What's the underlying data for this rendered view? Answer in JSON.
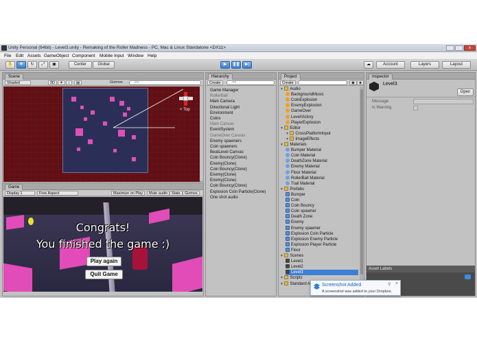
{
  "window": {
    "title": "Unity Personal (64bit) - Level3.unity - Remaking of the Roller Madness - PC, Mac & Linux Standalone <DX11>"
  },
  "menu": [
    "File",
    "Edit",
    "Assets",
    "GameObject",
    "Component",
    "Mobile Input",
    "Window",
    "Help"
  ],
  "toolbar": {
    "pivot": "Center",
    "space": "Global",
    "account": "Account",
    "layers": "Layers",
    "layout": "Layout"
  },
  "scene": {
    "tab": "Scene",
    "shading": "Shaded",
    "mode2d": "2D",
    "gizmos": "Gizmos",
    "search_placeholder": "All",
    "orientation": "Top"
  },
  "game": {
    "tab": "Game",
    "display": "Display 1",
    "aspect": "Free Aspect",
    "maximize": "Maximize on Play",
    "mute": "Mute audio",
    "stats": "Stats",
    "gizmos": "Gizmos",
    "line1": "Congrats!",
    "line2": "You finished the game :)",
    "play_again": "Play again",
    "quit_game": "Quit Game"
  },
  "hierarchy": {
    "tab": "Hierarchy",
    "create": "Create",
    "search_placeholder": "All",
    "items": [
      {
        "label": "Game Manager",
        "dim": false
      },
      {
        "label": "RollerBall",
        "dim": true
      },
      {
        "label": "Main Camera",
        "dim": false
      },
      {
        "label": "Directional Light",
        "dim": false
      },
      {
        "label": "Environment",
        "dim": false
      },
      {
        "label": "Coins",
        "dim": false
      },
      {
        "label": "Main Canvas",
        "dim": true
      },
      {
        "label": "EventSystem",
        "dim": false
      },
      {
        "label": "GameOver Canvas",
        "dim": true
      },
      {
        "label": "Enemy spawners",
        "dim": false
      },
      {
        "label": "Coin spawners",
        "dim": false
      },
      {
        "label": "BeatLevel Canvas",
        "dim": false
      },
      {
        "label": "Coin Bouncy(Clone)",
        "dim": false
      },
      {
        "label": "Enemy(Clone)",
        "dim": false
      },
      {
        "label": "Coin Bouncy(Clone)",
        "dim": false
      },
      {
        "label": "Enemy(Clone)",
        "dim": false
      },
      {
        "label": "Enemy(Clone)",
        "dim": false
      },
      {
        "label": "Coin Bouncy(Clone)",
        "dim": false
      },
      {
        "label": "Explosion Coin Particle(Clone)",
        "dim": false
      },
      {
        "label": "One shot audio",
        "dim": false
      }
    ]
  },
  "project": {
    "tab": "Project",
    "create": "Create",
    "items": [
      {
        "label": "Audio",
        "kind": "folder",
        "level": 0
      },
      {
        "label": "BackgroundMusic",
        "kind": "audio",
        "level": 1
      },
      {
        "label": "CoinExplosion",
        "kind": "audio",
        "level": 1
      },
      {
        "label": "EnemyExplosion",
        "kind": "audio",
        "level": 1
      },
      {
        "label": "GameOver",
        "kind": "audio",
        "level": 1
      },
      {
        "label": "LevelVictory",
        "kind": "audio",
        "level": 1
      },
      {
        "label": "PlayerExplosion",
        "kind": "audio",
        "level": 1
      },
      {
        "label": "Editor",
        "kind": "folder",
        "level": 0
      },
      {
        "label": "CrossPlatformInput",
        "kind": "folder",
        "level": 1
      },
      {
        "label": "ImageEffects",
        "kind": "folder",
        "level": 1
      },
      {
        "label": "Materials",
        "kind": "folder",
        "level": 0
      },
      {
        "label": "Bumper Material",
        "kind": "mat",
        "level": 1
      },
      {
        "label": "Coin Material",
        "kind": "mat",
        "level": 1
      },
      {
        "label": "DeathZone Material",
        "kind": "mat",
        "level": 1
      },
      {
        "label": "Enemy Material",
        "kind": "mat",
        "level": 1
      },
      {
        "label": "Floor Material",
        "kind": "mat",
        "level": 1
      },
      {
        "label": "RollerBall Material",
        "kind": "mat",
        "level": 1
      },
      {
        "label": "Trail Material",
        "kind": "mat",
        "level": 1
      },
      {
        "label": "Prefabs",
        "kind": "folder",
        "level": 0
      },
      {
        "label": "Bumper",
        "kind": "cube",
        "level": 1
      },
      {
        "label": "Coin",
        "kind": "cube",
        "level": 1
      },
      {
        "label": "Coin Bouncy",
        "kind": "cube",
        "level": 1
      },
      {
        "label": "Coin spawner",
        "kind": "cube",
        "level": 1
      },
      {
        "label": "Death Zone",
        "kind": "cube",
        "level": 1
      },
      {
        "label": "Enemy",
        "kind": "cube",
        "level": 1
      },
      {
        "label": "Enemy spawner",
        "kind": "cube",
        "level": 1
      },
      {
        "label": "Explosion Coin Particle",
        "kind": "cube",
        "level": 1
      },
      {
        "label": "Explosion Enemy Particle",
        "kind": "cube",
        "level": 1
      },
      {
        "label": "Explosion Player Particle",
        "kind": "cube",
        "level": 1
      },
      {
        "label": "Floor",
        "kind": "cube",
        "level": 1
      },
      {
        "label": "Scenes",
        "kind": "folder",
        "level": 0
      },
      {
        "label": "Level1",
        "kind": "scene",
        "level": 1
      },
      {
        "label": "Level2",
        "kind": "scene",
        "level": 1
      },
      {
        "label": "Level3",
        "kind": "scene",
        "level": 1,
        "selected": true
      },
      {
        "label": "Scripts",
        "kind": "folder",
        "level": 0
      },
      {
        "label": "Standard A",
        "kind": "folder",
        "level": 0
      }
    ]
  },
  "inspector": {
    "tab": "Inspector",
    "object_name": "Level3",
    "open": "Open",
    "message_label": "Message",
    "is_warning_label": "Is Warning",
    "asset_labels": "Asset Labels"
  },
  "notification": {
    "title": "Screenshot Added",
    "body": "A screenshot was added to your Dropbox."
  },
  "colors": {
    "accent_blue": "#3d7fd6",
    "pink_cube": "#e050b8",
    "scene_bg": "#5e1015"
  }
}
